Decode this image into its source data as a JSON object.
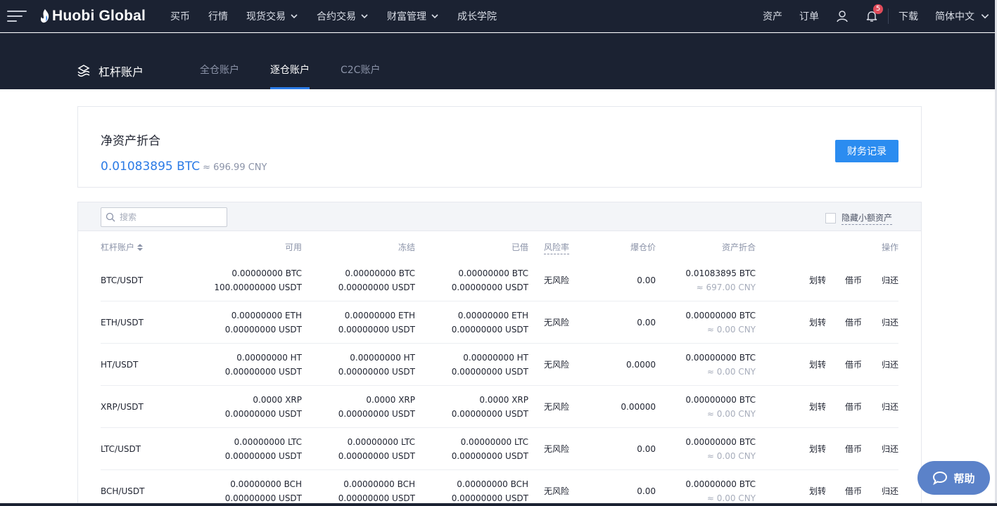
{
  "topbar": {
    "logo": "Huobi Global",
    "nav": [
      {
        "label": "买币",
        "dropdown": false
      },
      {
        "label": "行情",
        "dropdown": false
      },
      {
        "label": "现货交易",
        "dropdown": true
      },
      {
        "label": "合约交易",
        "dropdown": true
      },
      {
        "label": "财富管理",
        "dropdown": true
      },
      {
        "label": "成长学院",
        "dropdown": false
      }
    ],
    "assets": "资产",
    "orders": "订单",
    "notifications_count": "5",
    "download": "下载",
    "language": "简体中文"
  },
  "subbar": {
    "title": "杠杆账户",
    "tabs": [
      "全仓账户",
      "逐仓账户",
      "C2C账户"
    ],
    "active_tab": 1
  },
  "summary": {
    "heading": "净资产折合",
    "btc": "0.01083895 BTC",
    "cny": "≈ 696.99 CNY",
    "records_button": "财务记录"
  },
  "toolbar": {
    "search_placeholder": "搜索",
    "hide_small": "隐藏小额资产"
  },
  "table": {
    "headers": {
      "pair": "杠杆账户",
      "available": "可用",
      "frozen": "冻结",
      "borrowed": "已借",
      "risk": "风险率",
      "liq": "爆仓价",
      "value": "资产折合",
      "ops": "操作"
    },
    "actions": {
      "transfer": "划转",
      "borrow": "借币",
      "repay": "归还"
    },
    "rows": [
      {
        "pair": "BTC/USDT",
        "avail1": "0.00000000 BTC",
        "avail2": "100.00000000 USDT",
        "frozen1": "0.00000000 BTC",
        "frozen2": "0.00000000 USDT",
        "borrowed1": "0.00000000 BTC",
        "borrowed2": "0.00000000 USDT",
        "risk": "无风险",
        "liq": "0.00",
        "value_btc": "0.01083895 BTC",
        "value_cny": "≈ 697.00 CNY"
      },
      {
        "pair": "ETH/USDT",
        "avail1": "0.00000000 ETH",
        "avail2": "0.00000000 USDT",
        "frozen1": "0.00000000 ETH",
        "frozen2": "0.00000000 USDT",
        "borrowed1": "0.00000000 ETH",
        "borrowed2": "0.00000000 USDT",
        "risk": "无风险",
        "liq": "0.00",
        "value_btc": "0.00000000 BTC",
        "value_cny": "≈ 0.00 CNY"
      },
      {
        "pair": "HT/USDT",
        "avail1": "0.00000000 HT",
        "avail2": "0.00000000 USDT",
        "frozen1": "0.00000000 HT",
        "frozen2": "0.00000000 USDT",
        "borrowed1": "0.00000000 HT",
        "borrowed2": "0.00000000 USDT",
        "risk": "无风险",
        "liq": "0.0000",
        "value_btc": "0.00000000 BTC",
        "value_cny": "≈ 0.00 CNY"
      },
      {
        "pair": "XRP/USDT",
        "avail1": "0.0000 XRP",
        "avail2": "0.00000000 USDT",
        "frozen1": "0.0000 XRP",
        "frozen2": "0.00000000 USDT",
        "borrowed1": "0.0000 XRP",
        "borrowed2": "0.00000000 USDT",
        "risk": "无风险",
        "liq": "0.00000",
        "value_btc": "0.00000000 BTC",
        "value_cny": "≈ 0.00 CNY"
      },
      {
        "pair": "LTC/USDT",
        "avail1": "0.00000000 LTC",
        "avail2": "0.00000000 USDT",
        "frozen1": "0.00000000 LTC",
        "frozen2": "0.00000000 USDT",
        "borrowed1": "0.00000000 LTC",
        "borrowed2": "0.00000000 USDT",
        "risk": "无风险",
        "liq": "0.00",
        "value_btc": "0.00000000 BTC",
        "value_cny": "≈ 0.00 CNY"
      },
      {
        "pair": "BCH/USDT",
        "avail1": "0.00000000 BCH",
        "avail2": "0.00000000 USDT",
        "frozen1": "0.00000000 BCH",
        "frozen2": "0.00000000 USDT",
        "borrowed1": "0.00000000 BCH",
        "borrowed2": "0.00000000 USDT",
        "risk": "无风险",
        "liq": "0.00",
        "value_btc": "0.00000000 BTC",
        "value_cny": "≈ 0.00 CNY"
      }
    ]
  },
  "help": "帮助",
  "colors": {
    "accent": "#2b7be6",
    "header_bg": "#1b2232",
    "button": "#2b8cf0",
    "help_bg": "#5b82c9",
    "badge": "#e04b5a"
  }
}
